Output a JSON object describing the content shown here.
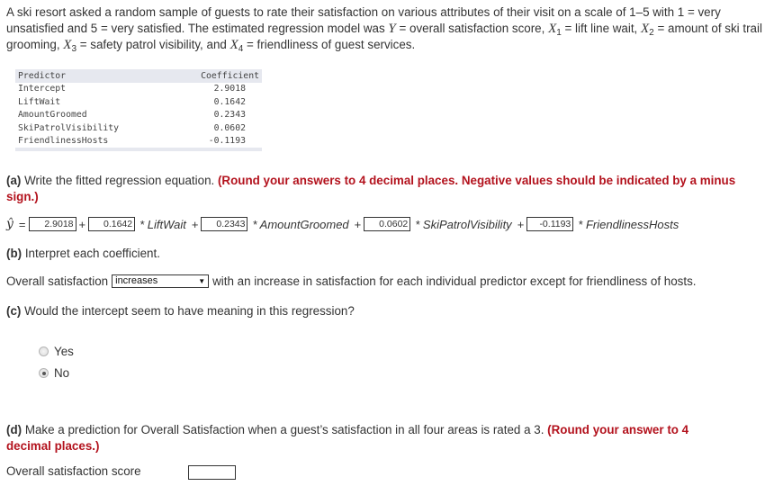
{
  "intro": {
    "part1": "A ski resort asked a random sample of guests to rate their satisfaction on various attributes of their visit on a scale of 1–5 with 1 = very unsatisfied and 5 = very satisfied. The estimated regression model was ",
    "y_var": "Y",
    "part2": " = overall satisfaction score, ",
    "x1": "X",
    "x1_sub": "1",
    "x1_desc": " = lift line wait, ",
    "x2": "X",
    "x2_sub": "2",
    "x2_desc": " = amount of ski trail grooming, ",
    "x3": "X",
    "x3_sub": "3",
    "x3_desc": " = safety patrol visibility, and ",
    "x4": "X",
    "x4_sub": "4",
    "x4_desc": " = friendliness of guest services."
  },
  "table": {
    "headers": [
      "Predictor",
      "Coefficient"
    ],
    "rows": [
      {
        "predictor": "Intercept",
        "coefficient": "2.9018"
      },
      {
        "predictor": "LiftWait",
        "coefficient": "0.1642"
      },
      {
        "predictor": "AmountGroomed",
        "coefficient": "0.2343"
      },
      {
        "predictor": "SkiPatrolVisibility",
        "coefficient": "0.0602"
      },
      {
        "predictor": "FriendlinessHosts",
        "coefficient": "-0.1193"
      }
    ]
  },
  "part_a": {
    "label": "(a)",
    "text": " Write the fitted regression equation. ",
    "instruction": "(Round your answers to 4 decimal places. Negative values should be indicated by a minus sign.)",
    "yhat": "ŷ",
    "equals": "=",
    "plus": "+",
    "inputs": [
      "2.9018",
      "0.1642",
      "0.2343",
      "0.0602",
      "-0.1193"
    ],
    "terms": [
      "* LiftWait",
      "* AmountGroomed",
      "* SkiPatrolVisibility",
      "* FriendlinessHosts"
    ]
  },
  "part_b": {
    "label": "(b)",
    "text": " Interpret each coefficient.",
    "prefix": "Overall satisfaction",
    "dropdown_value": "increases",
    "suffix": "with an increase in satisfaction for each individual predictor except for friendliness of hosts."
  },
  "part_c": {
    "label": "(c)",
    "text": " Would the intercept seem to have meaning in this regression?",
    "options": [
      {
        "label": "Yes",
        "checked": false
      },
      {
        "label": "No",
        "checked": true
      }
    ]
  },
  "part_d": {
    "label": "(d)",
    "text": " Make a prediction for Overall Satisfaction when a guest’s satisfaction in all four areas is rated a 3. ",
    "instruction": "(Round your answer to 4 decimal places.)",
    "field_label": "Overall satisfaction score",
    "field_value": ""
  }
}
